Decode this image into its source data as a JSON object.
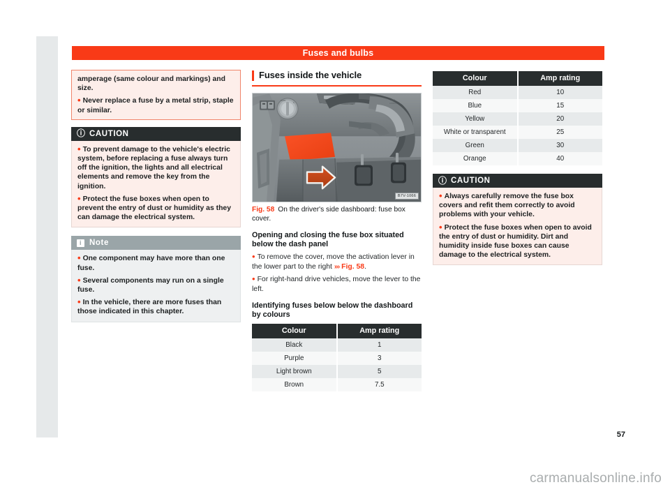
{
  "header": {
    "title": "Fuses and bulbs"
  },
  "page": {
    "number": "57",
    "watermark": "carmanualsonline.info"
  },
  "colors": {
    "accent": "#f93a17",
    "caution_header_bg": "#282d2e",
    "note_header_bg": "#9aa5a8",
    "caution_body_bg": "#fdeeea",
    "note_body_bg": "#eef0f1",
    "table_header_bg": "#282d2e",
    "table_row_odd": "#e7eaeb",
    "table_row_even": "#f7f8f8",
    "page_frame": "#e6e9ea"
  },
  "left_column": {
    "continued_box": {
      "line1": "amperage (same colour and markings) and size.",
      "bullet1": "Never replace a fuse by a metal strip, staple or similar."
    },
    "caution": {
      "label": "CAUTION",
      "icon": "warning-icon",
      "bullets": [
        "To prevent damage to the vehicle's electric system, before replacing a fuse always turn off the ignition, the lights and all electrical elements and remove the key from the ignition.",
        "Protect the fuse boxes when open to prevent the entry of dust or humidity as they can damage the electrical system."
      ]
    },
    "note": {
      "label": "Note",
      "icon": "info-icon",
      "bullets": [
        "One component may have more than one fuse.",
        "Several components may run on a single fuse.",
        "In the vehicle, there are more fuses than those indicated in this chapter."
      ]
    }
  },
  "middle_column": {
    "section_title": "Fuses inside the vehicle",
    "figure": {
      "id_label": "B7V-1066",
      "fig_number": "Fig. 58",
      "caption": "On the driver's side dashboard: fuse box cover.",
      "alt": "Driver's side dashboard with fuse box cover highlighted in orange and an arrow pointing right"
    },
    "sub_head_1": "Opening and closing the fuse box situated below the dash panel",
    "para_1_a": "To remove the cover, move the activation lever in the lower part to the right ",
    "para_1_chev": "›››",
    "para_1_ref": "Fig. 58",
    "para_1_end": ".",
    "para_2": "For right-hand drive vehicles, move the lever to the left.",
    "sub_head_2": "Identifying fuses below below the dashboard by colours",
    "table": {
      "headers": [
        "Colour",
        "Amp rating"
      ],
      "rows": [
        [
          "Black",
          "1"
        ],
        [
          "Purple",
          "3"
        ],
        [
          "Light brown",
          "5"
        ],
        [
          "Brown",
          "7.5"
        ]
      ]
    }
  },
  "right_column": {
    "table": {
      "headers": [
        "Colour",
        "Amp rating"
      ],
      "rows": [
        [
          "Red",
          "10"
        ],
        [
          "Blue",
          "15"
        ],
        [
          "Yellow",
          "20"
        ],
        [
          "White or transparent",
          "25"
        ],
        [
          "Green",
          "30"
        ],
        [
          "Orange",
          "40"
        ]
      ]
    },
    "caution": {
      "label": "CAUTION",
      "icon": "warning-icon",
      "bullets": [
        "Always carefully remove the fuse box covers and refit them correctly to avoid problems with your vehicle.",
        "Protect the fuse boxes when open to avoid the entry of dust or humidity. Dirt and humidity inside fuse boxes can cause damage to the electrical system."
      ]
    }
  }
}
